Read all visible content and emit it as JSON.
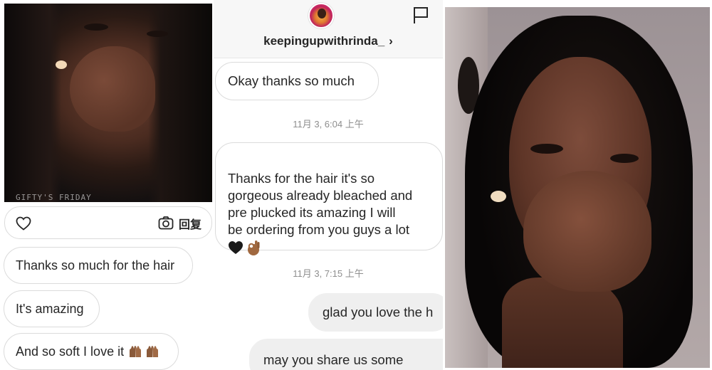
{
  "left_panel": {
    "photo_overlay_text": "GIFTY'S FRIDAY",
    "reply_label": "回复",
    "messages": [
      {
        "text": "Thanks so much for the hair"
      },
      {
        "text": "It's amazing"
      },
      {
        "text": "And so soft I love it"
      }
    ]
  },
  "middle_panel": {
    "header": {
      "username": "keepingupwithrinda_"
    },
    "messages": [
      {
        "type": "received",
        "text": "Okay thanks so much"
      },
      {
        "type": "timestamp",
        "text": "11月 3, 6:04 上午"
      },
      {
        "type": "received",
        "text": "Thanks for the hair it's so\ngorgeous already bleached and\npre plucked its amazing I will\nbe ordering from you guys a lot"
      },
      {
        "type": "timestamp",
        "text": "11月 3, 7:15 上午"
      },
      {
        "type": "sent",
        "text": "glad you love the h"
      },
      {
        "type": "sent",
        "text": "may you share us some"
      }
    ]
  },
  "colors": {
    "bubble_border": "#dbdbdb",
    "sent_bubble": "#efefef",
    "timestamp": "#8e8e8e",
    "text": "#262626"
  }
}
